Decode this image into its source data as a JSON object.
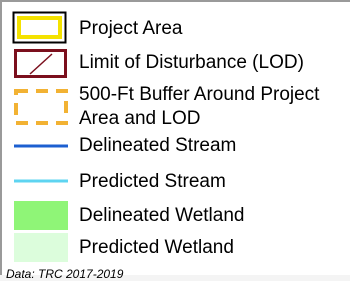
{
  "legend": {
    "items": [
      {
        "label": "Project Area",
        "symbol": "yellow-outline-box",
        "color": "#f4e200"
      },
      {
        "label": "Limit of Disturbance (LOD)",
        "symbol": "box-with-diagonal",
        "color": "#7b0f1d"
      },
      {
        "label_line1": "500-Ft Buffer Around Project",
        "label_line2": "Area and LOD",
        "symbol": "dashed-orange-box",
        "color": "#f2b233"
      },
      {
        "label": "Delineated Stream",
        "symbol": "line",
        "color": "#1c5fd0"
      },
      {
        "label": "Predicted Stream",
        "symbol": "line",
        "color": "#5ed4f1"
      },
      {
        "label": "Delineated Wetland",
        "symbol": "filled-box",
        "color": "#8ff577"
      },
      {
        "label": "Predicted Wetland",
        "symbol": "filled-box",
        "color": "#dcfddc"
      }
    ],
    "footer": "Data: TRC 2017-2019"
  }
}
